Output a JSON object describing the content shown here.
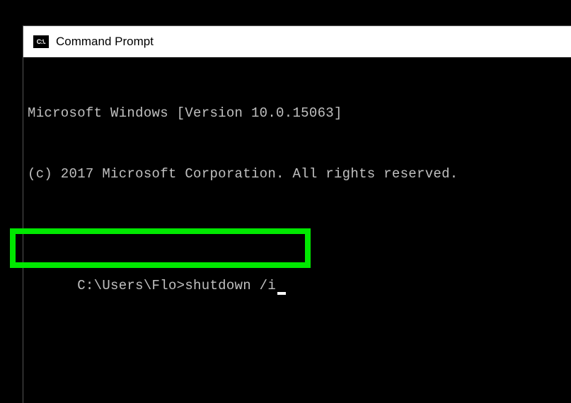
{
  "window": {
    "title": "Command Prompt",
    "icon_label": "C:\\."
  },
  "terminal": {
    "version_line": "Microsoft Windows [Version 10.0.15063]",
    "copyright_line": "(c) 2017 Microsoft Corporation. All rights reserved.",
    "prompt": "C:\\Users\\Flo>",
    "command": "shutdown /i"
  },
  "colors": {
    "highlight": "#00e800",
    "terminal_bg": "#000000",
    "terminal_fg": "#c0c0c0"
  }
}
